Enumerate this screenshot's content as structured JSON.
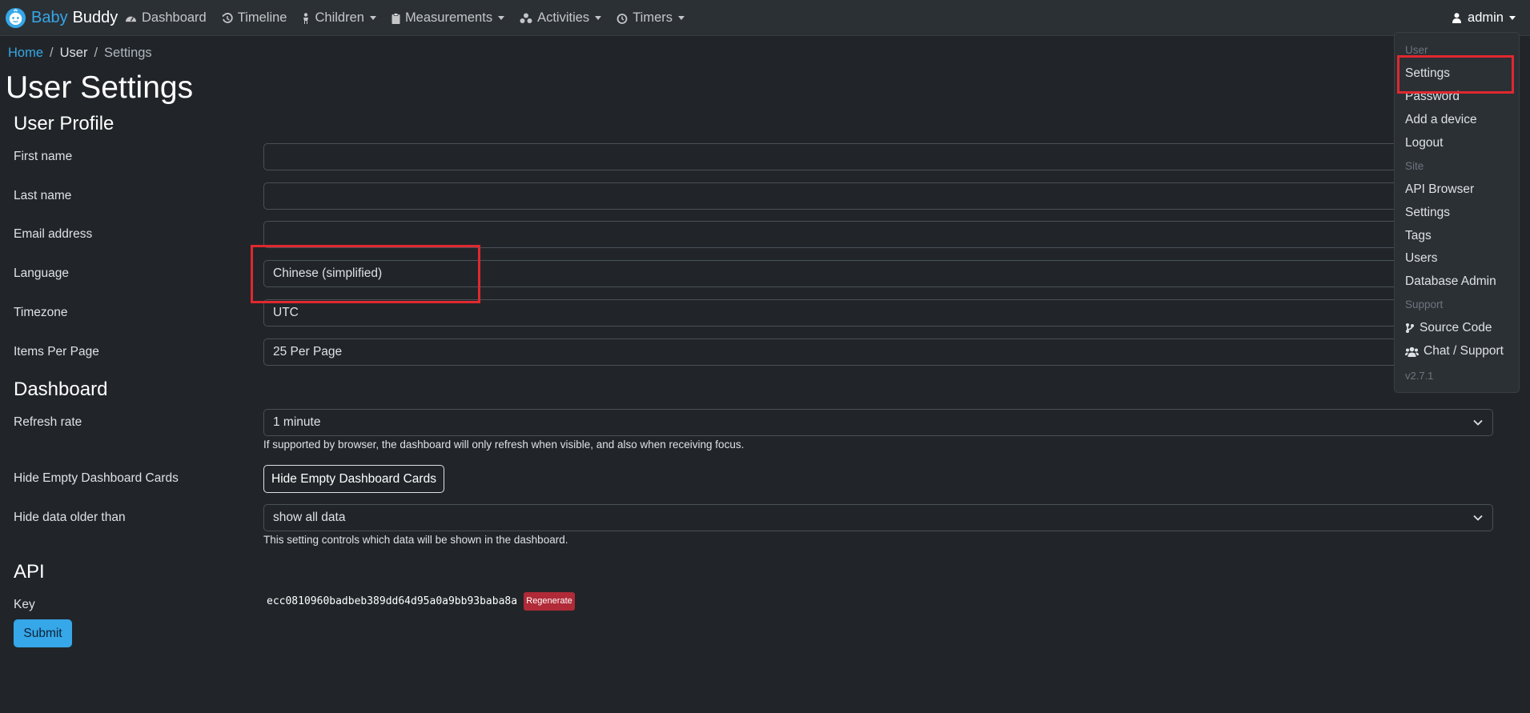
{
  "brand": {
    "name_part1": "Baby",
    "name_part2": "Buddy"
  },
  "nav": {
    "items": [
      {
        "label": "Dashboard",
        "icon": "dashboard-icon"
      },
      {
        "label": "Timeline",
        "icon": "history-icon"
      },
      {
        "label": "Children",
        "icon": "child-icon"
      },
      {
        "label": "Measurements",
        "icon": "clipboard-icon"
      },
      {
        "label": "Activities",
        "icon": "activities-icon"
      },
      {
        "label": "Timers",
        "icon": "timer-icon"
      }
    ],
    "user": "admin"
  },
  "breadcrumb": {
    "home": "Home",
    "user": "User",
    "current": "Settings"
  },
  "page_title": "User Settings",
  "profile": {
    "title": "User Profile",
    "first_name_label": "First name",
    "first_name_value": "",
    "last_name_label": "Last name",
    "last_name_value": "",
    "email_label": "Email address",
    "email_value": "",
    "language_label": "Language",
    "language_value": "Chinese (simplified)",
    "timezone_label": "Timezone",
    "timezone_value": "UTC",
    "items_per_page_label": "Items Per Page",
    "items_per_page_value": "25 Per Page"
  },
  "dashboard": {
    "title": "Dashboard",
    "refresh_label": "Refresh rate",
    "refresh_value": "1 minute",
    "refresh_help": "If supported by browser, the dashboard will only refresh when visible, and also when receiving focus.",
    "hide_empty_label": "Hide Empty Dashboard Cards",
    "hide_empty_button": "Hide Empty Dashboard Cards",
    "hide_older_label": "Hide data older than",
    "hide_older_value": "show all data",
    "hide_older_help": "This setting controls which data will be shown in the dashboard."
  },
  "api": {
    "title": "API",
    "key_label": "Key",
    "key_value": "ecc0810960badbeb389dd64d95a0a9bb93baba8a",
    "regenerate": "Regenerate"
  },
  "submit": "Submit",
  "dropdown": {
    "user_header": "User",
    "settings": "Settings",
    "password": "Password",
    "add_device": "Add a device",
    "logout": "Logout",
    "site_header": "Site",
    "api_browser": "API Browser",
    "site_settings": "Settings",
    "tags": "Tags",
    "users": "Users",
    "database_admin": "Database Admin",
    "support_header": "Support",
    "source_code": "Source Code",
    "chat_support": "Chat / Support",
    "version": "v2.7.1"
  },
  "colors": {
    "accent": "#36a7e8",
    "danger": "#b02a37",
    "highlight": "#e0282f",
    "background": "#212529"
  }
}
